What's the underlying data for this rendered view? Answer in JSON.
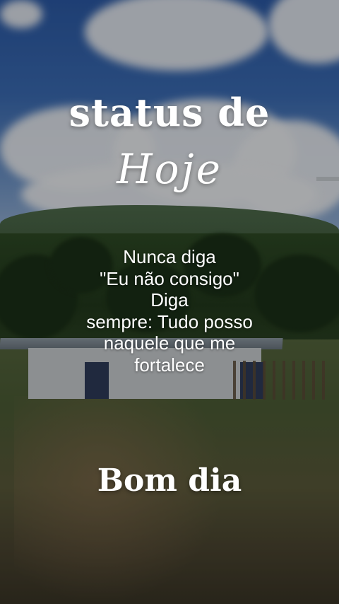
{
  "post": {
    "title": "status de",
    "script_title": "Hoje",
    "quote_lines": [
      "Nunca diga",
      "\"Eu não consigo\"",
      "Diga",
      "sempre: Tudo posso",
      "naquele que me",
      "fortalece"
    ],
    "greeting": "Bom dia"
  },
  "colors": {
    "text": "#ffffff",
    "sky": "#2c5aa6",
    "field": "#55663d"
  }
}
